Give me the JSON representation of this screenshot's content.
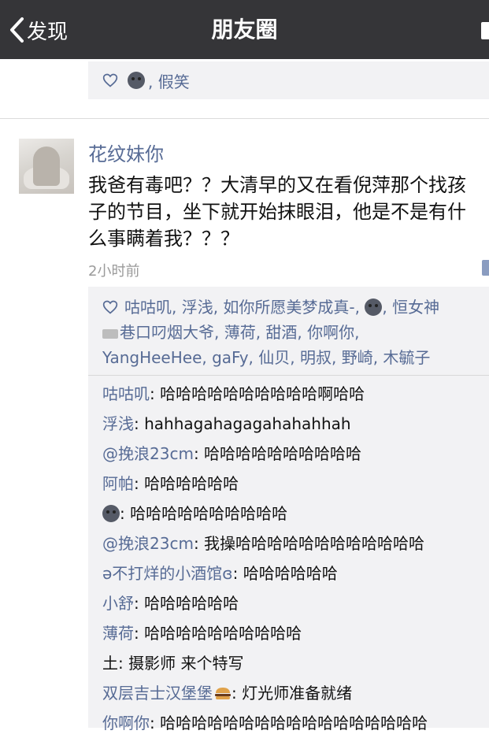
{
  "nav": {
    "back_label": "发现",
    "title": "朋友圈"
  },
  "prev_post": {
    "likes_text": ", 假笑"
  },
  "post": {
    "author": "花纹妹你",
    "text_lines": [
      "我爸有毒吧？？大清早的又在看倪萍那个找孩",
      "子的节目，坐下就开始抹眼泪，他是不是有什",
      "么事瞒着我？？？"
    ],
    "time": "2小时前"
  },
  "likes": {
    "line1_a": "咕咕叽, 浮浅, 如你所愿美梦成真-,",
    "line1_b": ", 恒女神",
    "line2": "巷口叼烟大爷, 薄荷, 甜酒, 你啊你,",
    "line3": "YangHeeHee, gaFy, 仙贝, 明叔, 野崎, 木毓子"
  },
  "comments": [
    {
      "name": "咕咕叽",
      "text": ": 哈哈哈哈哈哈哈哈哈哈啊哈哈"
    },
    {
      "name": "浮浅",
      "text": ": hahhagahagagahahahhah"
    },
    {
      "name": "@挽浪23cm",
      "text": ": 哈哈哈哈哈哈哈哈哈哈"
    },
    {
      "name": "阿帕",
      "text": ": 哈哈哈哈哈哈"
    },
    {
      "name": "",
      "text": ": 哈哈哈哈哈哈哈哈哈哈"
    },
    {
      "name": "@挽浪23cm",
      "text": ": 我操哈哈哈哈哈哈哈哈哈哈哈哈"
    },
    {
      "name": "ə不打烊的小酒馆ɞ",
      "text": ": 哈哈哈哈哈哈"
    },
    {
      "name": "小舒",
      "text": ": 哈哈哈哈哈哈"
    },
    {
      "name": "薄荷",
      "text": ": 哈哈哈哈哈哈哈哈哈哈"
    },
    {
      "name": "土",
      "text": ": 摄影师 来个特写"
    },
    {
      "name": "双层吉士汉堡堡",
      "text": ": 灯光师准备就绪"
    },
    {
      "name": "你啊你",
      "text": ": 哈哈哈哈哈哈哈哈哈哈哈哈哈哈哈哈哈"
    }
  ],
  "colors": {
    "navbar": "#353538",
    "link": "#576b95",
    "comment_bg": "#f2f2f4"
  }
}
